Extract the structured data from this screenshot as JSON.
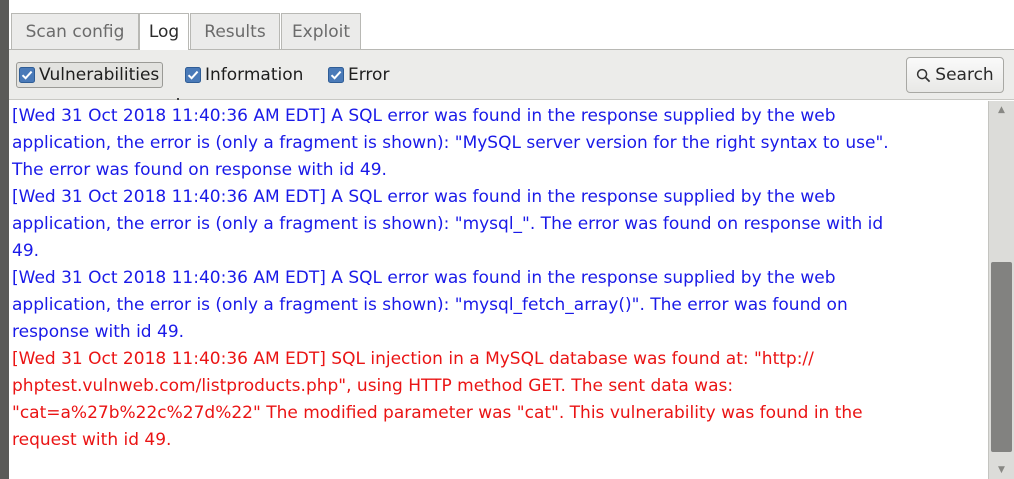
{
  "tabs": [
    {
      "label": "Scan config",
      "active": false
    },
    {
      "label": "Log",
      "active": true
    },
    {
      "label": "Results",
      "active": false
    },
    {
      "label": "Exploit",
      "active": false
    }
  ],
  "filters": [
    {
      "label": "Vulnerabilities",
      "checked": true
    },
    {
      "label": "Information",
      "checked": true
    },
    {
      "label": "Error",
      "checked": true
    }
  ],
  "search": {
    "label": "Search",
    "icon": "search-icon"
  },
  "log": {
    "entries": [
      {
        "color": "#1a1ae8",
        "text": "[Wed 31 Oct 2018 11:40:36 AM EDT] A SQL error was found in the response supplied by the web\napplication, the error is (only a fragment is shown): \"MySQL server version for the right syntax to use\".\nThe error was found on response with id 49."
      },
      {
        "color": "#1a1ae8",
        "text": "[Wed 31 Oct 2018 11:40:36 AM EDT] A SQL error was found in the response supplied by the web\napplication, the error is (only a fragment is shown): \"mysql_\". The error was found on response with id\n49."
      },
      {
        "color": "#1a1ae8",
        "text": "[Wed 31 Oct 2018 11:40:36 AM EDT] A SQL error was found in the response supplied by the web\napplication, the error is (only a fragment is shown): \"mysql_fetch_array()\". The error was found on\nresponse with id 49."
      },
      {
        "color": "#ea1414",
        "text": "[Wed 31 Oct 2018 11:40:36 AM EDT] SQL injection in a MySQL database was found at: \"http://\nphptest.vulnweb.com/listproducts.php\", using HTTP method GET. The sent data was:\n\"cat=a%27b%22c%27d%22\" The modified parameter was \"cat\". This vulnerability was found in the\nrequest with id 49."
      }
    ]
  },
  "colors": {
    "info": "#1a1ae8",
    "vulnerability": "#ea1414",
    "checkbox_accent": "#4a7ab8"
  }
}
